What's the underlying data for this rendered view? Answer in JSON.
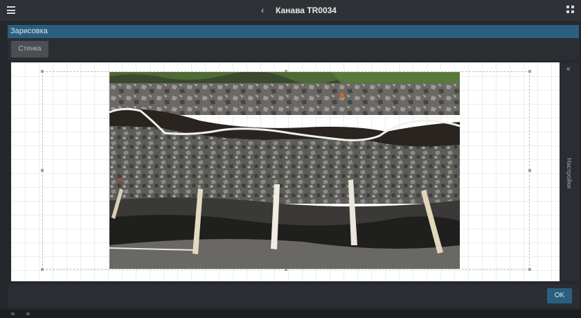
{
  "app": {
    "title": "Канава TR0034",
    "back_icon": "chevron-left-icon",
    "menu_icon": "hamburger-icon",
    "apps_icon": "grid-icon"
  },
  "section": {
    "title": "Зарисовка"
  },
  "toolbar": {
    "tabs": [
      {
        "label": "Стенка",
        "active": true
      }
    ]
  },
  "side_panel": {
    "label": "Настройки",
    "toggle_icon": "chevron-left-icon"
  },
  "footer": {
    "ok_label": "OK"
  },
  "colors": {
    "accent": "#2b5f7f",
    "background": "#24282c",
    "topbar": "#2e3236",
    "canvas": "#ffffff"
  }
}
